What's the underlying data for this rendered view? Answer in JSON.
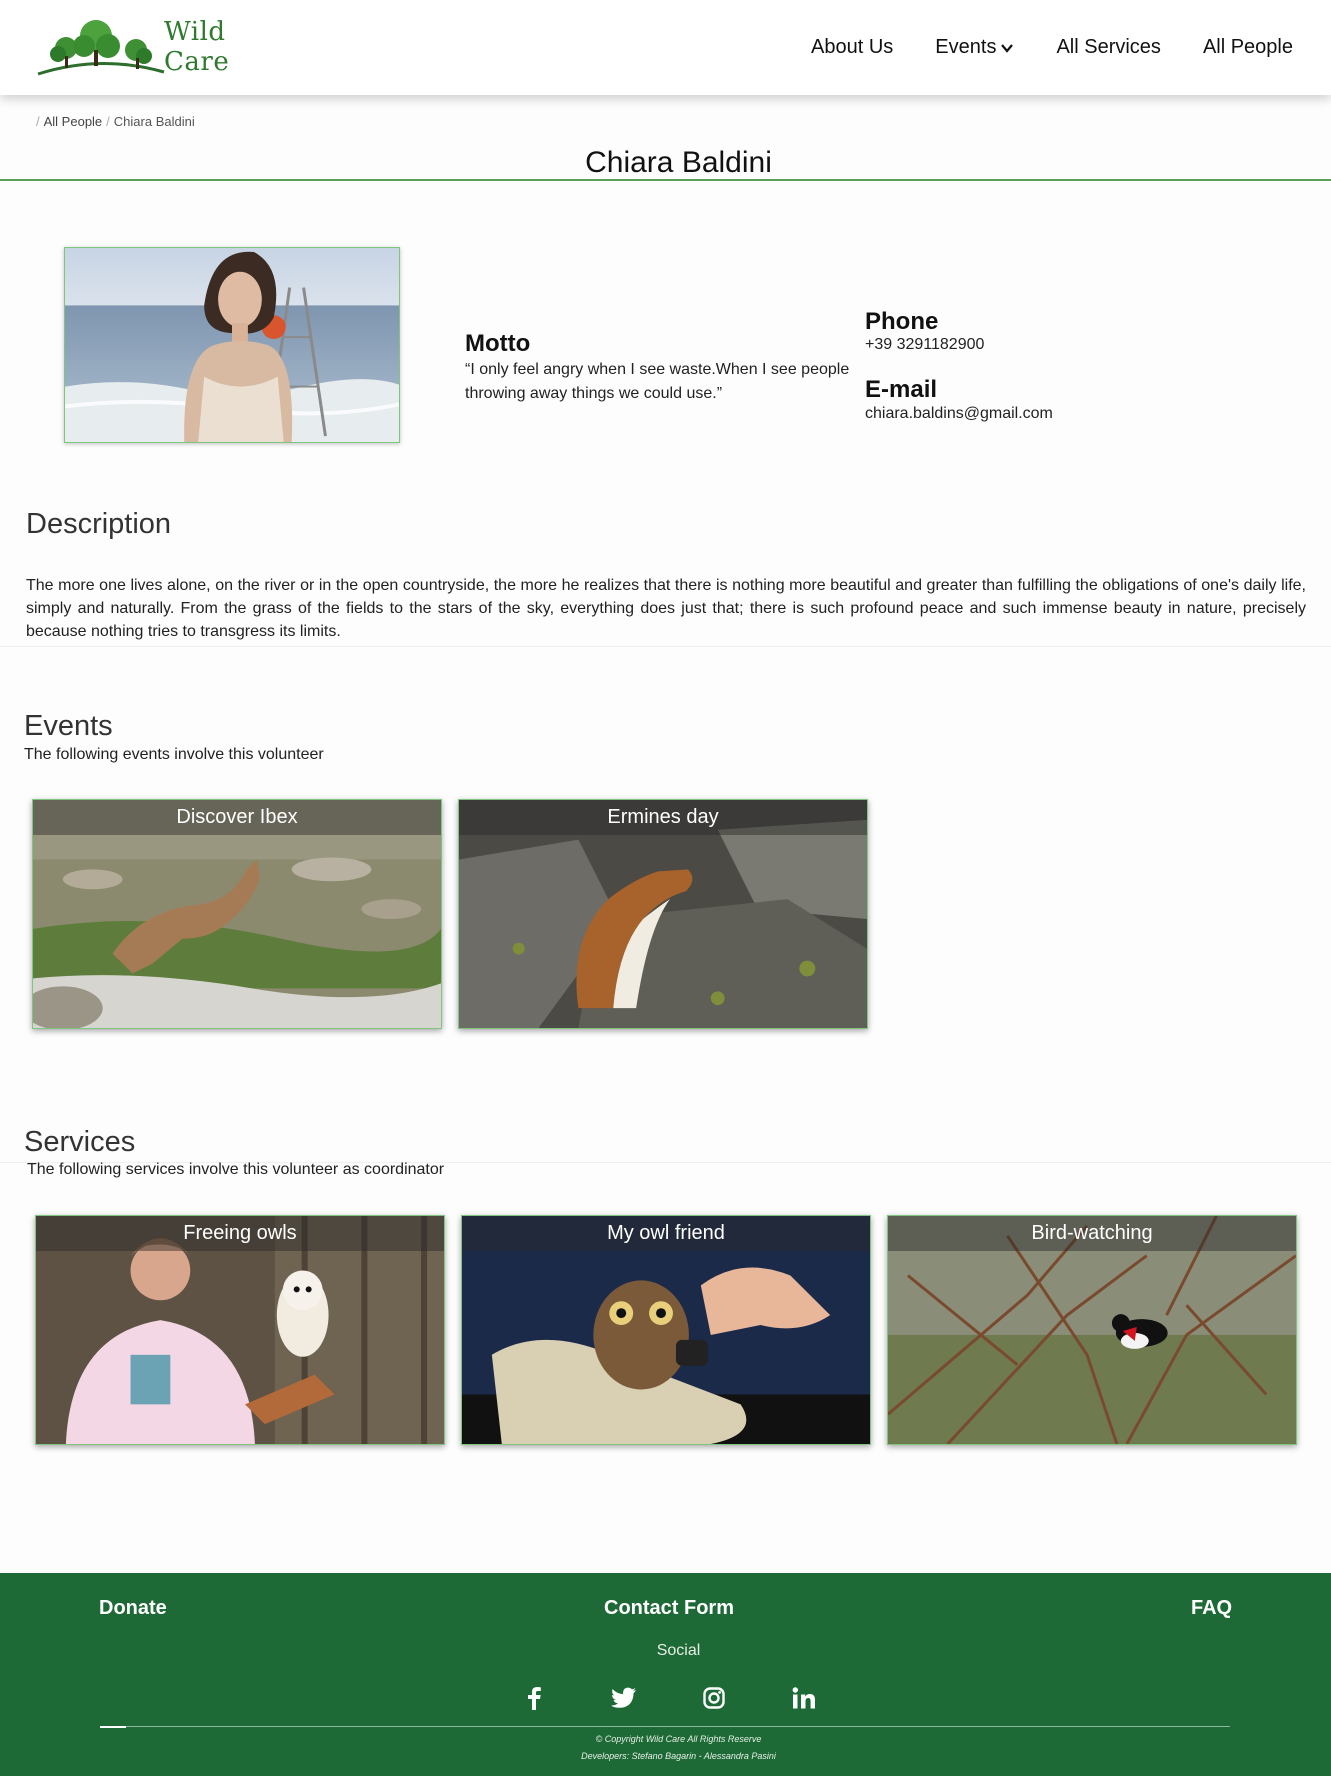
{
  "brand": {
    "name": "Wild Care",
    "logo_icon": "trees-logo-icon"
  },
  "nav": {
    "items": [
      {
        "label": "About Us"
      },
      {
        "label": "Events",
        "icon": "chevron-down-icon"
      },
      {
        "label": "All Services"
      },
      {
        "label": "All People"
      }
    ]
  },
  "breadcrumb": {
    "items": [
      "All People",
      "Chiara Baldini"
    ]
  },
  "page_title": "Chiara Baldini",
  "profile": {
    "motto_label": "Motto",
    "motto": "“I only feel angry when I see waste.When I see people throwing away things we could use.”",
    "phone_label": "Phone",
    "phone": "+39 3291182900",
    "email_label": "E-mail",
    "email": "chiara.baldins@gmail.com"
  },
  "description": {
    "title": "Description",
    "text": "The more one lives alone, on the river or in the open countryside, the more he realizes that there is nothing more beautiful and greater than fulfilling the obligations of one's daily life, simply and naturally. From the grass of the fields to the stars of the sky, everything does just that; there is such profound peace and such immense beauty in nature, precisely because nothing tries to transgress its limits."
  },
  "events": {
    "title": "Events",
    "subtitle": "The following events involve this volunteer",
    "cards": [
      {
        "title": "Discover Ibex"
      },
      {
        "title": "Ermines day"
      }
    ]
  },
  "services": {
    "title": "Services",
    "subtitle": "The following services involve this volunteer as coordinator",
    "cards": [
      {
        "title": "Freeing owls"
      },
      {
        "title": "My owl friend"
      },
      {
        "title": "Bird-watching"
      }
    ]
  },
  "footer": {
    "donate": "Donate",
    "contact": "Contact Form",
    "faq": "FAQ",
    "social_label": "Social",
    "social_icons": [
      "facebook-icon",
      "twitter-icon",
      "instagram-icon",
      "linkedin-icon"
    ],
    "copyright": "© Copyright Wild Care All Rights Reserve",
    "developers": "Developers: Stefano Bagarin - Alessandra Pasini",
    "bg_color": "#1e6a37"
  }
}
